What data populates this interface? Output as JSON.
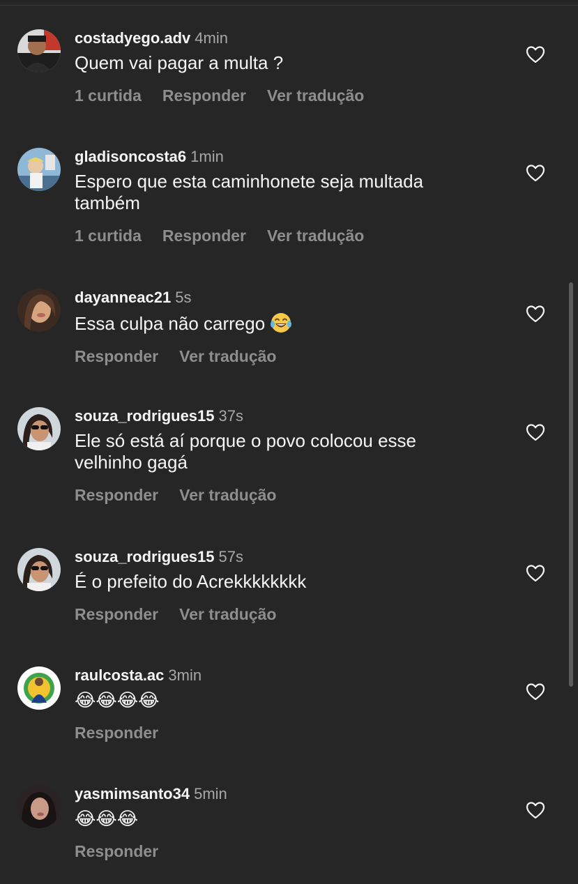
{
  "colors": {
    "background": "#262626",
    "primary_text": "#f5f5f5",
    "secondary_text": "#a8a8a8",
    "action_text": "#8e8e8e"
  },
  "comments": [
    {
      "username": "costadyego.adv",
      "time": "4min",
      "text": "Quem vai pagar a multa ?",
      "likes": "1 curtida",
      "reply": "Responder",
      "translate": "Ver tradução",
      "avatar_icon": "avatar-photo"
    },
    {
      "username": "gladisoncosta6",
      "time": "1min",
      "text": "Espero que esta caminhonete seja multada\ntambém",
      "likes": "1 curtida",
      "reply": "Responder",
      "translate": "Ver tradução",
      "avatar_icon": "avatar-photo"
    },
    {
      "username": "dayanneac21",
      "time": "5s",
      "text": "Essa culpa não carrego",
      "emoji": "😂",
      "reply": "Responder",
      "translate": "Ver tradução",
      "avatar_icon": "avatar-photo"
    },
    {
      "username": "souza_rodrigues15",
      "time": "37s",
      "text": "Ele só está aí porque o povo colocou esse\nvelhinho gagá",
      "reply": "Responder",
      "translate": "Ver tradução",
      "avatar_icon": "avatar-photo"
    },
    {
      "username": "souza_rodrigues15",
      "time": "57s",
      "text": "É o prefeito do Acrekkkkkkkk",
      "reply": "Responder",
      "translate": "Ver tradução",
      "avatar_icon": "avatar-photo"
    },
    {
      "username": "raulcosta.ac",
      "time": "3min",
      "text": "😂😂😂😂",
      "reply": "Responder",
      "avatar_icon": "avatar-photo"
    },
    {
      "username": "yasmimsanto34",
      "time": "5min",
      "text": "😂😂😂",
      "reply": "Responder",
      "avatar_icon": "avatar-photo"
    }
  ],
  "icons": {
    "like": "heart-outline-icon",
    "emoji": "tears-of-joy-emoji"
  }
}
